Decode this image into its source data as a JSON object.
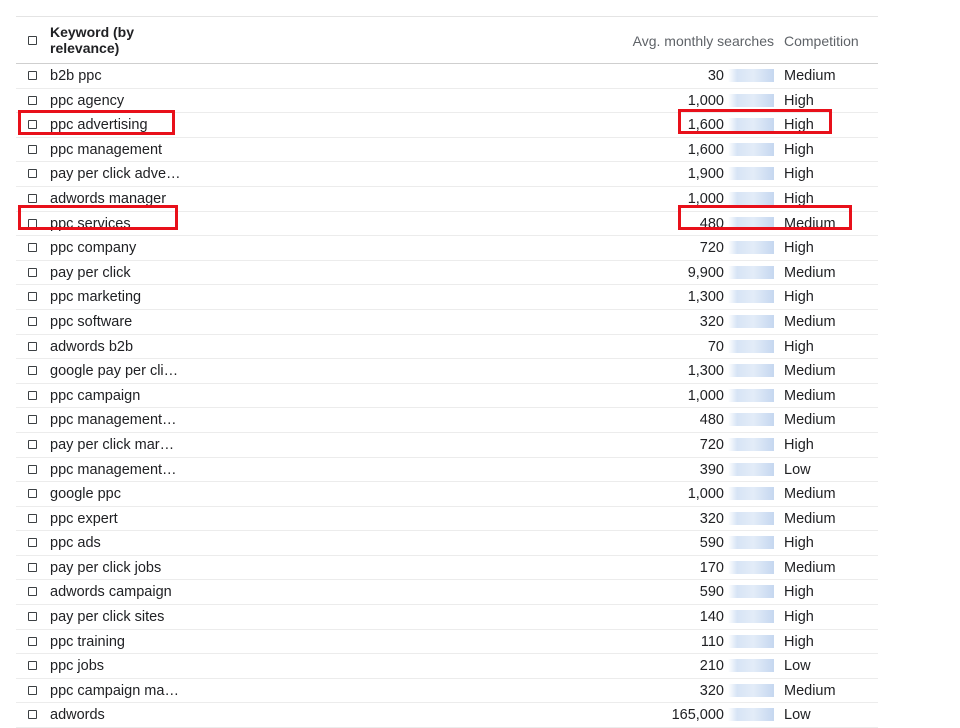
{
  "header": {
    "keyword": "Keyword (by relevance)",
    "avg_monthly_searches": "Avg. monthly searches",
    "competition": "Competition"
  },
  "rows": [
    {
      "keyword": "b2b ppc",
      "searches": "30",
      "competition": "Medium"
    },
    {
      "keyword": "ppc agency",
      "searches": "1,000",
      "competition": "High"
    },
    {
      "keyword": "ppc advertising",
      "searches": "1,600",
      "competition": "High"
    },
    {
      "keyword": "ppc management",
      "searches": "1,600",
      "competition": "High"
    },
    {
      "keyword": "pay per click adve…",
      "searches": "1,900",
      "competition": "High"
    },
    {
      "keyword": "adwords manager",
      "searches": "1,000",
      "competition": "High"
    },
    {
      "keyword": "ppc services",
      "searches": "480",
      "competition": "Medium"
    },
    {
      "keyword": "ppc company",
      "searches": "720",
      "competition": "High"
    },
    {
      "keyword": "pay per click",
      "searches": "9,900",
      "competition": "Medium"
    },
    {
      "keyword": "ppc marketing",
      "searches": "1,300",
      "competition": "High"
    },
    {
      "keyword": "ppc software",
      "searches": "320",
      "competition": "Medium"
    },
    {
      "keyword": "adwords b2b",
      "searches": "70",
      "competition": "High"
    },
    {
      "keyword": "google pay per cli…",
      "searches": "1,300",
      "competition": "Medium"
    },
    {
      "keyword": "ppc campaign",
      "searches": "1,000",
      "competition": "Medium"
    },
    {
      "keyword": "ppc management…",
      "searches": "480",
      "competition": "Medium"
    },
    {
      "keyword": "pay per click mar…",
      "searches": "720",
      "competition": "High"
    },
    {
      "keyword": "ppc management…",
      "searches": "390",
      "competition": "Low"
    },
    {
      "keyword": "google ppc",
      "searches": "1,000",
      "competition": "Medium"
    },
    {
      "keyword": "ppc expert",
      "searches": "320",
      "competition": "Medium"
    },
    {
      "keyword": "ppc ads",
      "searches": "590",
      "competition": "High"
    },
    {
      "keyword": "pay per click jobs",
      "searches": "170",
      "competition": "Medium"
    },
    {
      "keyword": "adwords campaign",
      "searches": "590",
      "competition": "High"
    },
    {
      "keyword": "pay per click sites",
      "searches": "140",
      "competition": "High"
    },
    {
      "keyword": "ppc training",
      "searches": "110",
      "competition": "High"
    },
    {
      "keyword": "ppc jobs",
      "searches": "210",
      "competition": "Low"
    },
    {
      "keyword": "ppc campaign ma…",
      "searches": "320",
      "competition": "Medium"
    },
    {
      "keyword": "adwords",
      "searches": "165,000",
      "competition": "Low"
    }
  ],
  "highlight_color": "#e8101a",
  "trend_color": "#c5d7f0"
}
